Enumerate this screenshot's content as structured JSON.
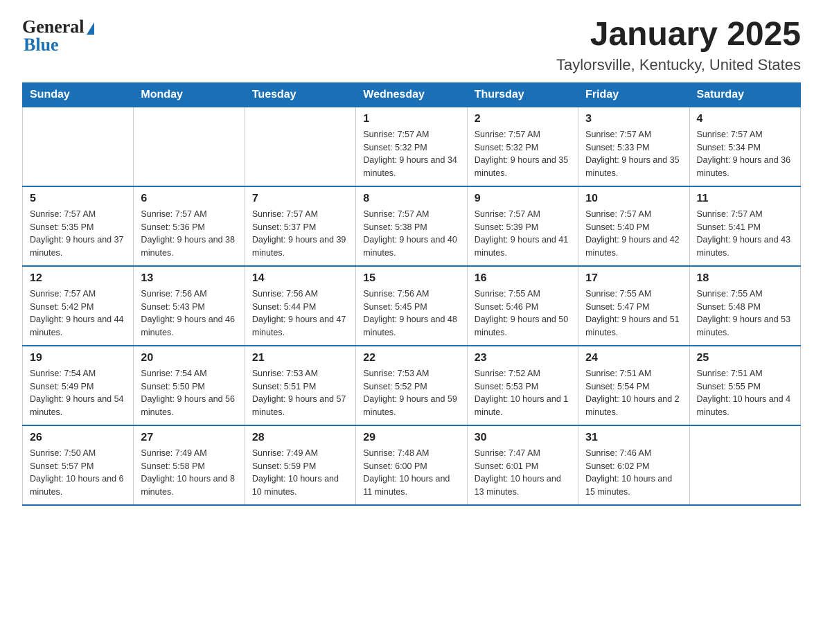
{
  "header": {
    "logo_text_general": "General",
    "logo_text_blue": "Blue",
    "title": "January 2025",
    "subtitle": "Taylorsville, Kentucky, United States"
  },
  "days_of_week": [
    "Sunday",
    "Monday",
    "Tuesday",
    "Wednesday",
    "Thursday",
    "Friday",
    "Saturday"
  ],
  "weeks": [
    [
      {
        "day": "",
        "sunrise": "",
        "sunset": "",
        "daylight": ""
      },
      {
        "day": "",
        "sunrise": "",
        "sunset": "",
        "daylight": ""
      },
      {
        "day": "",
        "sunrise": "",
        "sunset": "",
        "daylight": ""
      },
      {
        "day": "1",
        "sunrise": "Sunrise: 7:57 AM",
        "sunset": "Sunset: 5:32 PM",
        "daylight": "Daylight: 9 hours and 34 minutes."
      },
      {
        "day": "2",
        "sunrise": "Sunrise: 7:57 AM",
        "sunset": "Sunset: 5:32 PM",
        "daylight": "Daylight: 9 hours and 35 minutes."
      },
      {
        "day": "3",
        "sunrise": "Sunrise: 7:57 AM",
        "sunset": "Sunset: 5:33 PM",
        "daylight": "Daylight: 9 hours and 35 minutes."
      },
      {
        "day": "4",
        "sunrise": "Sunrise: 7:57 AM",
        "sunset": "Sunset: 5:34 PM",
        "daylight": "Daylight: 9 hours and 36 minutes."
      }
    ],
    [
      {
        "day": "5",
        "sunrise": "Sunrise: 7:57 AM",
        "sunset": "Sunset: 5:35 PM",
        "daylight": "Daylight: 9 hours and 37 minutes."
      },
      {
        "day": "6",
        "sunrise": "Sunrise: 7:57 AM",
        "sunset": "Sunset: 5:36 PM",
        "daylight": "Daylight: 9 hours and 38 minutes."
      },
      {
        "day": "7",
        "sunrise": "Sunrise: 7:57 AM",
        "sunset": "Sunset: 5:37 PM",
        "daylight": "Daylight: 9 hours and 39 minutes."
      },
      {
        "day": "8",
        "sunrise": "Sunrise: 7:57 AM",
        "sunset": "Sunset: 5:38 PM",
        "daylight": "Daylight: 9 hours and 40 minutes."
      },
      {
        "day": "9",
        "sunrise": "Sunrise: 7:57 AM",
        "sunset": "Sunset: 5:39 PM",
        "daylight": "Daylight: 9 hours and 41 minutes."
      },
      {
        "day": "10",
        "sunrise": "Sunrise: 7:57 AM",
        "sunset": "Sunset: 5:40 PM",
        "daylight": "Daylight: 9 hours and 42 minutes."
      },
      {
        "day": "11",
        "sunrise": "Sunrise: 7:57 AM",
        "sunset": "Sunset: 5:41 PM",
        "daylight": "Daylight: 9 hours and 43 minutes."
      }
    ],
    [
      {
        "day": "12",
        "sunrise": "Sunrise: 7:57 AM",
        "sunset": "Sunset: 5:42 PM",
        "daylight": "Daylight: 9 hours and 44 minutes."
      },
      {
        "day": "13",
        "sunrise": "Sunrise: 7:56 AM",
        "sunset": "Sunset: 5:43 PM",
        "daylight": "Daylight: 9 hours and 46 minutes."
      },
      {
        "day": "14",
        "sunrise": "Sunrise: 7:56 AM",
        "sunset": "Sunset: 5:44 PM",
        "daylight": "Daylight: 9 hours and 47 minutes."
      },
      {
        "day": "15",
        "sunrise": "Sunrise: 7:56 AM",
        "sunset": "Sunset: 5:45 PM",
        "daylight": "Daylight: 9 hours and 48 minutes."
      },
      {
        "day": "16",
        "sunrise": "Sunrise: 7:55 AM",
        "sunset": "Sunset: 5:46 PM",
        "daylight": "Daylight: 9 hours and 50 minutes."
      },
      {
        "day": "17",
        "sunrise": "Sunrise: 7:55 AM",
        "sunset": "Sunset: 5:47 PM",
        "daylight": "Daylight: 9 hours and 51 minutes."
      },
      {
        "day": "18",
        "sunrise": "Sunrise: 7:55 AM",
        "sunset": "Sunset: 5:48 PM",
        "daylight": "Daylight: 9 hours and 53 minutes."
      }
    ],
    [
      {
        "day": "19",
        "sunrise": "Sunrise: 7:54 AM",
        "sunset": "Sunset: 5:49 PM",
        "daylight": "Daylight: 9 hours and 54 minutes."
      },
      {
        "day": "20",
        "sunrise": "Sunrise: 7:54 AM",
        "sunset": "Sunset: 5:50 PM",
        "daylight": "Daylight: 9 hours and 56 minutes."
      },
      {
        "day": "21",
        "sunrise": "Sunrise: 7:53 AM",
        "sunset": "Sunset: 5:51 PM",
        "daylight": "Daylight: 9 hours and 57 minutes."
      },
      {
        "day": "22",
        "sunrise": "Sunrise: 7:53 AM",
        "sunset": "Sunset: 5:52 PM",
        "daylight": "Daylight: 9 hours and 59 minutes."
      },
      {
        "day": "23",
        "sunrise": "Sunrise: 7:52 AM",
        "sunset": "Sunset: 5:53 PM",
        "daylight": "Daylight: 10 hours and 1 minute."
      },
      {
        "day": "24",
        "sunrise": "Sunrise: 7:51 AM",
        "sunset": "Sunset: 5:54 PM",
        "daylight": "Daylight: 10 hours and 2 minutes."
      },
      {
        "day": "25",
        "sunrise": "Sunrise: 7:51 AM",
        "sunset": "Sunset: 5:55 PM",
        "daylight": "Daylight: 10 hours and 4 minutes."
      }
    ],
    [
      {
        "day": "26",
        "sunrise": "Sunrise: 7:50 AM",
        "sunset": "Sunset: 5:57 PM",
        "daylight": "Daylight: 10 hours and 6 minutes."
      },
      {
        "day": "27",
        "sunrise": "Sunrise: 7:49 AM",
        "sunset": "Sunset: 5:58 PM",
        "daylight": "Daylight: 10 hours and 8 minutes."
      },
      {
        "day": "28",
        "sunrise": "Sunrise: 7:49 AM",
        "sunset": "Sunset: 5:59 PM",
        "daylight": "Daylight: 10 hours and 10 minutes."
      },
      {
        "day": "29",
        "sunrise": "Sunrise: 7:48 AM",
        "sunset": "Sunset: 6:00 PM",
        "daylight": "Daylight: 10 hours and 11 minutes."
      },
      {
        "day": "30",
        "sunrise": "Sunrise: 7:47 AM",
        "sunset": "Sunset: 6:01 PM",
        "daylight": "Daylight: 10 hours and 13 minutes."
      },
      {
        "day": "31",
        "sunrise": "Sunrise: 7:46 AM",
        "sunset": "Sunset: 6:02 PM",
        "daylight": "Daylight: 10 hours and 15 minutes."
      },
      {
        "day": "",
        "sunrise": "",
        "sunset": "",
        "daylight": ""
      }
    ]
  ]
}
